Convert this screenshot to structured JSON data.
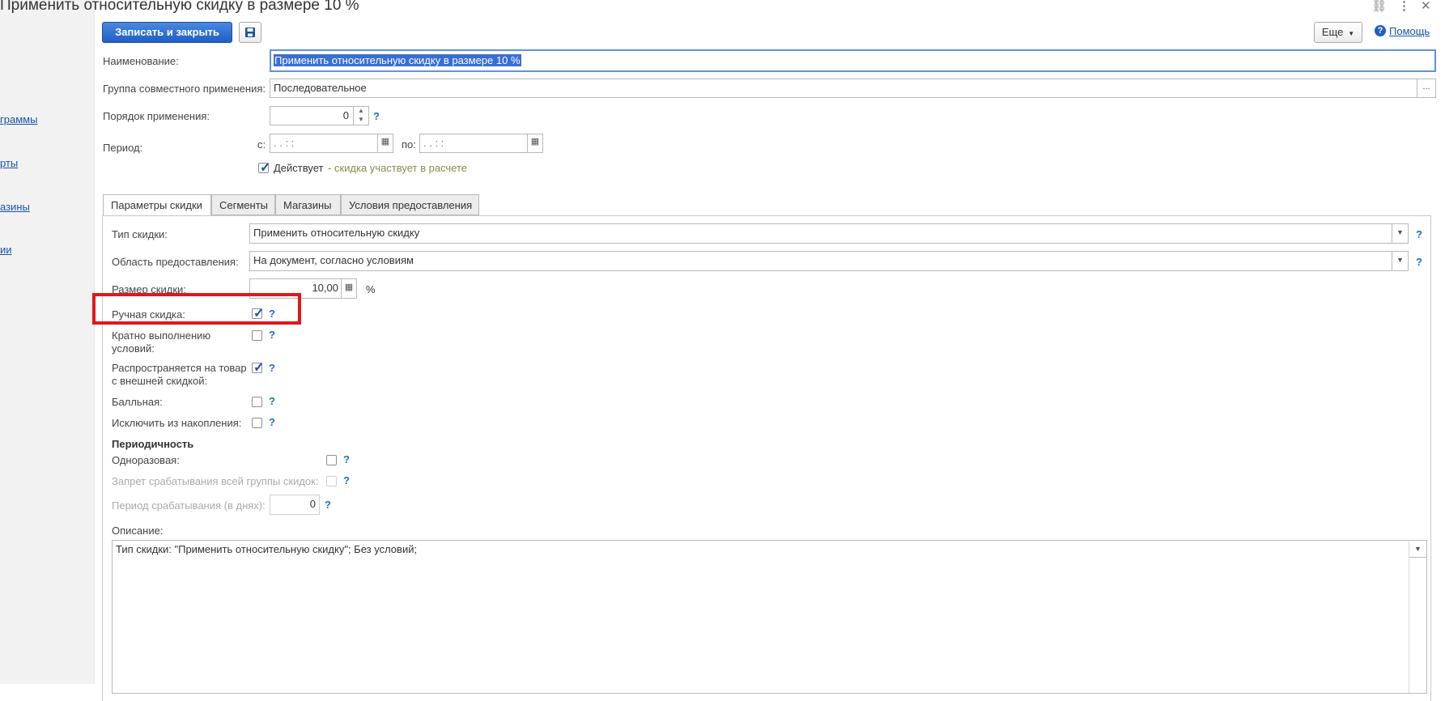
{
  "window": {
    "title": "Применить относительную скидку в размере 10 %",
    "link_icon": "link-icon",
    "more_icon": "more-vertical-icon",
    "close_icon": "close-icon"
  },
  "left_nav": [
    {
      "label": "граммы"
    },
    {
      "label": "рты"
    },
    {
      "label": "азины"
    },
    {
      "label": "ии"
    }
  ],
  "toolbar": {
    "save_close_label": "Записать и закрыть",
    "save_icon": "save-icon",
    "more_label": "Еще",
    "help_label": "Помощь"
  },
  "form": {
    "name_label": "Наименование:",
    "name_value": "Применить относительную скидку в размере 10 %",
    "group_label": "Группа совместного применения:",
    "group_value": "Последовательное",
    "group_btn": "...",
    "order_label": "Порядок применения:",
    "order_value": "0",
    "period_label": "Период:",
    "period_from_label": "с:",
    "period_from_value": " .  .      :  :",
    "period_to_label": "по:",
    "period_to_value": " .  .      :  :",
    "active_label": "Действует",
    "active_hint": "- скидка участвует в расчете",
    "active_checked": true
  },
  "tabs": [
    {
      "label": "Параметры скидки",
      "active": true
    },
    {
      "label": "Сегменты",
      "active": false
    },
    {
      "label": "Магазины",
      "active": false
    },
    {
      "label": "Условия предоставления",
      "active": false
    }
  ],
  "params": {
    "type_label": "Тип скидки:",
    "type_value": "Применить относительную скидку",
    "area_label": "Область предоставления:",
    "area_value": "На документ, согласно условиям",
    "size_label": "Размер скидки:",
    "size_value": "10,00",
    "size_unit": "%",
    "manual_label": "Ручная скидка:",
    "manual_checked": true,
    "multiple_label_1": "Кратно выполнению",
    "multiple_label_2": "условий:",
    "multiple_checked": false,
    "external_label_1": "Распространяется на товар",
    "external_label_2": "с внешней скидкой:",
    "external_checked": true,
    "points_label": "Балльная:",
    "points_checked": false,
    "exclude_label": "Исключить из накопления:",
    "exclude_checked": false,
    "periodicity_heading": "Периодичность",
    "onetime_label": "Одноразовая:",
    "onetime_checked": false,
    "block_group_label": "Запрет срабатывания всей группы скидок:",
    "block_group_checked": false,
    "trigger_period_label": "Период срабатывания (в днях):",
    "trigger_period_value": "0",
    "description_label": "Описание:",
    "description_value": "Тип скидки: \"Применить относительную скидку\"; Без условий;"
  },
  "help_mark": "?",
  "colors": {
    "primary_button": "#1f5fc4",
    "link": "#1a52a8",
    "highlight_box": "#e0171c",
    "selection": "#3a6ed6"
  }
}
